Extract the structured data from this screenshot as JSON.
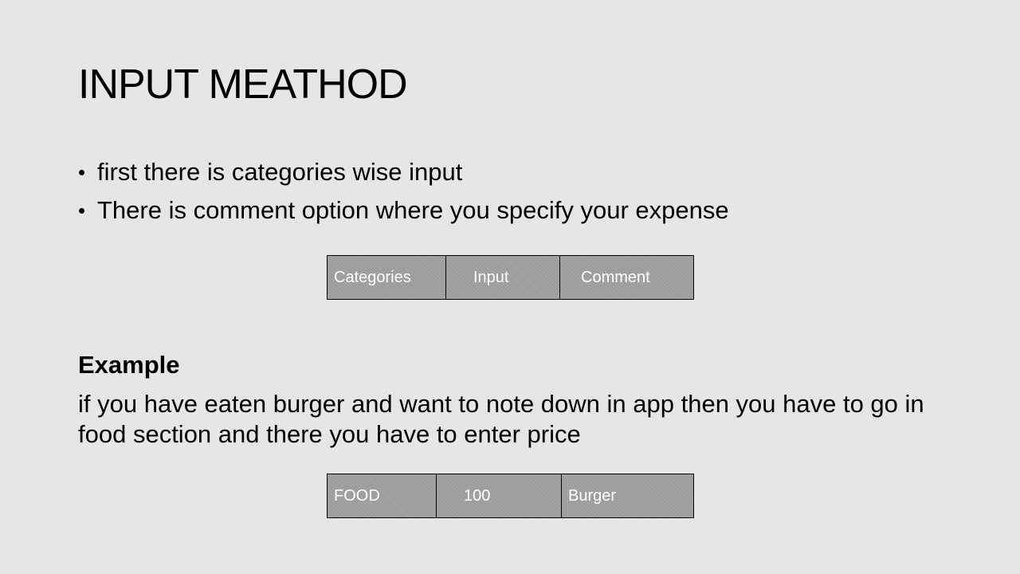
{
  "slide": {
    "title": "INPUT MEATHOD",
    "bullets": [
      "first there is categories wise input",
      "There is comment option where you specify your expense"
    ],
    "table_1": {
      "cells": [
        "Categories",
        "Input",
        "Comment"
      ]
    },
    "example_heading": "Example",
    "example_text": "if you have eaten burger  and want to note down in app then you have to go in food section and there you have to enter price",
    "table_2": {
      "cells": [
        "FOOD",
        "100",
        "Burger"
      ]
    },
    "colors": {
      "background": "#e6e6e6",
      "table_fill": "#9c9c9c",
      "table_text": "#ffffff",
      "border": "#000000"
    }
  }
}
